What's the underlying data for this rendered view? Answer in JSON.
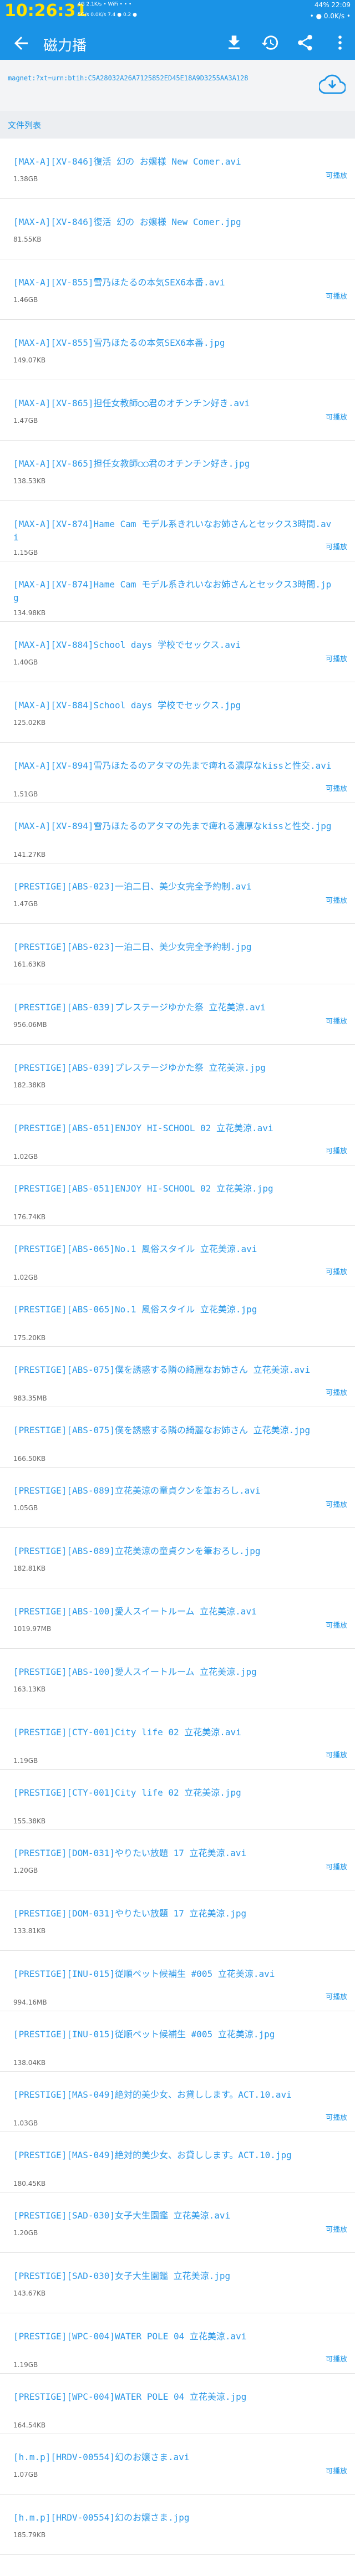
{
  "status_bar": {
    "time": "10:26:31",
    "left_info": "4G 2.1K/s  •  WiFi  •  •  •",
    "left_info2": "5G/s 0.0K/s 7.4 ● 0.2 ●",
    "right_info": "44% 22:09",
    "right_info2": "• ● 0.0K/s •"
  },
  "app_bar": {
    "title": "磁力播"
  },
  "magnet": {
    "text": "magnet:?xt=urn:btih:C5A28032A26A7125852ED45E18A9D3255AA3A128"
  },
  "section": {
    "label": "文件列表"
  },
  "files": [
    {
      "name": "[MAX-A][XV-846]復活 幻の お嬢様 New Comer.avi",
      "size": "1.38GB",
      "play": "可播放"
    },
    {
      "name": "[MAX-A][XV-846]復活 幻の お嬢様 New Comer.jpg",
      "size": "81.55KB",
      "play": ""
    },
    {
      "name": "[MAX-A][XV-855]雪乃ほたるの本気SEX6本番.avi",
      "size": "1.46GB",
      "play": "可播放"
    },
    {
      "name": "[MAX-A][XV-855]雪乃ほたるの本気SEX6本番.jpg",
      "size": "149.07KB",
      "play": ""
    },
    {
      "name": "[MAX-A][XV-865]担任女教師◯◯君のオチンチン好き.avi",
      "size": "1.47GB",
      "play": "可播放"
    },
    {
      "name": "[MAX-A][XV-865]担任女教師◯◯君のオチンチン好き.jpg",
      "size": "138.53KB",
      "play": ""
    },
    {
      "name": "[MAX-A][XV-874]Hame Cam モデル系きれいなお姉さんとセックス3時間.avi",
      "size": "1.15GB",
      "play": "可播放"
    },
    {
      "name": "[MAX-A][XV-874]Hame Cam モデル系きれいなお姉さんとセックス3時間.jpg",
      "size": "134.98KB",
      "play": ""
    },
    {
      "name": "[MAX-A][XV-884]School days 学校でセックス.avi",
      "size": "1.40GB",
      "play": "可播放"
    },
    {
      "name": "[MAX-A][XV-884]School days 学校でセックス.jpg",
      "size": "125.02KB",
      "play": ""
    },
    {
      "name": "[MAX-A][XV-894]雪乃ほたるのアタマの先まで痺れる濃厚なkissと性交.avi",
      "size": "1.51GB",
      "play": "可播放"
    },
    {
      "name": "[MAX-A][XV-894]雪乃ほたるのアタマの先まで痺れる濃厚なkissと性交.jpg",
      "size": "141.27KB",
      "play": ""
    },
    {
      "name": "[PRESTIGE][ABS-023]一泊二日、美少女完全予約制.avi",
      "size": "1.47GB",
      "play": "可播放"
    },
    {
      "name": "[PRESTIGE][ABS-023]一泊二日、美少女完全予約制.jpg",
      "size": "161.63KB",
      "play": ""
    },
    {
      "name": "[PRESTIGE][ABS-039]プレステージゆかた祭 立花美涼.avi",
      "size": "956.06MB",
      "play": "可播放"
    },
    {
      "name": "[PRESTIGE][ABS-039]プレステージゆかた祭 立花美涼.jpg",
      "size": "182.38KB",
      "play": ""
    },
    {
      "name": "[PRESTIGE][ABS-051]ENJOY HI-SCHOOL 02 立花美涼.avi",
      "size": "1.02GB",
      "play": "可播放"
    },
    {
      "name": "[PRESTIGE][ABS-051]ENJOY HI-SCHOOL 02 立花美涼.jpg",
      "size": "176.74KB",
      "play": ""
    },
    {
      "name": "[PRESTIGE][ABS-065]No.1 風俗スタイル 立花美涼.avi",
      "size": "1.02GB",
      "play": "可播放"
    },
    {
      "name": "[PRESTIGE][ABS-065]No.1 風俗スタイル 立花美涼.jpg",
      "size": "175.20KB",
      "play": ""
    },
    {
      "name": "[PRESTIGE][ABS-075]僕を誘惑する隣の綺麗なお姉さん 立花美涼.avi",
      "size": "983.35MB",
      "play": "可播放"
    },
    {
      "name": "[PRESTIGE][ABS-075]僕を誘惑する隣の綺麗なお姉さん 立花美涼.jpg",
      "size": "166.50KB",
      "play": ""
    },
    {
      "name": "[PRESTIGE][ABS-089]立花美涼の童貞クンを筆おろし.avi",
      "size": "1.05GB",
      "play": "可播放"
    },
    {
      "name": "[PRESTIGE][ABS-089]立花美涼の童貞クンを筆おろし.jpg",
      "size": "182.81KB",
      "play": ""
    },
    {
      "name": "[PRESTIGE][ABS-100]愛人スイートルーム 立花美涼.avi",
      "size": "1019.97MB",
      "play": "可播放"
    },
    {
      "name": "[PRESTIGE][ABS-100]愛人スイートルーム 立花美涼.jpg",
      "size": "163.13KB",
      "play": ""
    },
    {
      "name": "[PRESTIGE][CTY-001]City life 02 立花美涼.avi",
      "size": "1.19GB",
      "play": "可播放"
    },
    {
      "name": "[PRESTIGE][CTY-001]City life 02 立花美涼.jpg",
      "size": "155.38KB",
      "play": ""
    },
    {
      "name": "[PRESTIGE][DOM-031]やりたい放題 17 立花美涼.avi",
      "size": "1.20GB",
      "play": "可播放"
    },
    {
      "name": "[PRESTIGE][DOM-031]やりたい放題 17 立花美涼.jpg",
      "size": "133.81KB",
      "play": ""
    },
    {
      "name": "[PRESTIGE][INU-015]従順ペット候補生 #005 立花美涼.avi",
      "size": "994.16MB",
      "play": "可播放"
    },
    {
      "name": "[PRESTIGE][INU-015]従順ペット候補生 #005 立花美涼.jpg",
      "size": "138.04KB",
      "play": ""
    },
    {
      "name": "[PRESTIGE][MAS-049]絶対的美少女、お貸しします。ACT.10.avi",
      "size": "1.03GB",
      "play": "可播放"
    },
    {
      "name": "[PRESTIGE][MAS-049]絶対的美少女、お貸しします。ACT.10.jpg",
      "size": "180.45KB",
      "play": ""
    },
    {
      "name": "[PRESTIGE][SAD-030]女子大生園鑑 立花美涼.avi",
      "size": "1.20GB",
      "play": "可播放"
    },
    {
      "name": "[PRESTIGE][SAD-030]女子大生園鑑 立花美涼.jpg",
      "size": "143.67KB",
      "play": ""
    },
    {
      "name": "[PRESTIGE][WPC-004]WATER POLE 04 立花美涼.avi",
      "size": "1.19GB",
      "play": "可播放"
    },
    {
      "name": "[PRESTIGE][WPC-004]WATER POLE 04 立花美涼.jpg",
      "size": "164.54KB",
      "play": ""
    },
    {
      "name": "[h.m.p][HRDV-00554]幻のお嬢さま.avi",
      "size": "1.07GB",
      "play": "可播放"
    },
    {
      "name": "[h.m.p][HRDV-00554]幻のお嬢さま.jpg",
      "size": "185.79KB",
      "play": ""
    }
  ]
}
